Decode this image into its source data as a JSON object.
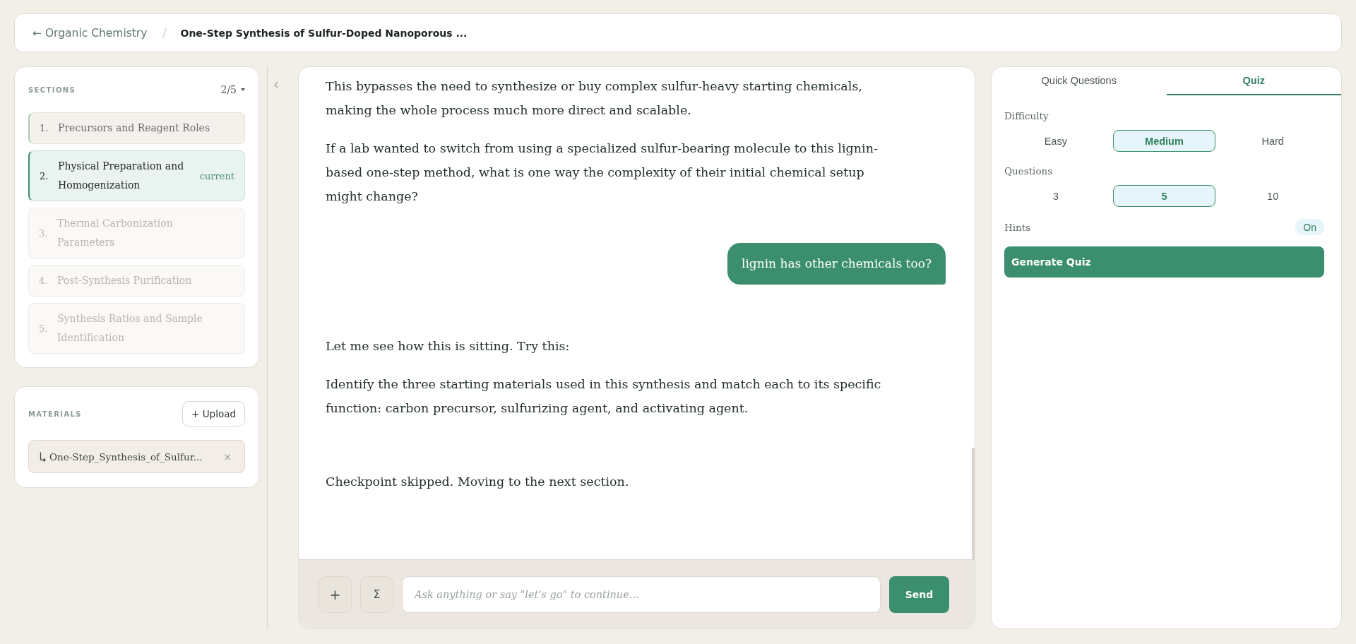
{
  "breadcrumb": {
    "back_link": "← Organic Chemistry",
    "separator": "/",
    "title": "One-Step Synthesis of Sulfur-Doped Nanoporous ..."
  },
  "sections": {
    "heading": "SECTIONS",
    "progress": "2/5",
    "items": [
      {
        "number": "1.",
        "title": "Precursors and Reagent Roles",
        "selected": false,
        "done": true,
        "locked": false
      },
      {
        "number": "2.",
        "title": "Physical Preparation and Homogenization",
        "selected": true,
        "done": false,
        "locked": false,
        "badge": "current"
      },
      {
        "number": "3.",
        "title": "Thermal Carbonization Parameters",
        "selected": false,
        "done": false,
        "locked": true
      },
      {
        "number": "4.",
        "title": "Post-Synthesis Purification",
        "selected": false,
        "done": false,
        "locked": true
      },
      {
        "number": "5.",
        "title": "Synthesis Ratios and Sample Identification",
        "selected": false,
        "done": false,
        "locked": true
      }
    ]
  },
  "materials": {
    "heading": "MATERIALS",
    "upload_button": "+ Upload",
    "files": [
      {
        "name": "One-Step_Synthesis_of_Sulfur...",
        "remove": "×"
      }
    ]
  },
  "chat": {
    "messages": [
      {
        "kind": "assistant",
        "paragraphs": [
          "This bypasses the need to synthesize or buy complex sulfur-heavy starting chemicals, making the whole process much more direct and scalable.",
          "If a lab wanted to switch from using a specialized sulfur-bearing molecule to this lignin-based one-step method, what is one way the complexity of their initial chemical setup might change?"
        ]
      },
      {
        "kind": "user",
        "text": "lignin has other chemicals too?"
      },
      {
        "kind": "assistant",
        "paragraphs": [
          "Let me see how this is sitting. Try this:",
          "Identify the three starting materials used in this synthesis and match each to its specific function: carbon precursor, sulfurizing agent, and activating agent."
        ]
      },
      {
        "kind": "assistant",
        "paragraphs": [
          "Checkpoint skipped. Moving to the next section."
        ]
      }
    ]
  },
  "composer": {
    "plus_button": "+",
    "math_button": "Σ",
    "placeholder": "Ask anything or say \"let's go\" to continue...",
    "send_button": "Send"
  },
  "quiz_panel": {
    "tabs": [
      {
        "label": "Quick Questions",
        "selected": false
      },
      {
        "label": "Quiz",
        "selected": true
      }
    ],
    "difficulty": {
      "label": "Difficulty",
      "options": [
        {
          "label": "Easy",
          "selected": false
        },
        {
          "label": "Medium",
          "selected": true
        },
        {
          "label": "Hard",
          "selected": false
        }
      ]
    },
    "questions": {
      "label": "Questions",
      "options": [
        {
          "label": "3",
          "selected": false
        },
        {
          "label": "5",
          "selected": true
        },
        {
          "label": "10",
          "selected": false
        }
      ]
    },
    "hints": {
      "label": "Hints",
      "value": "On",
      "on": true
    },
    "generate_button": "Generate Quiz"
  }
}
